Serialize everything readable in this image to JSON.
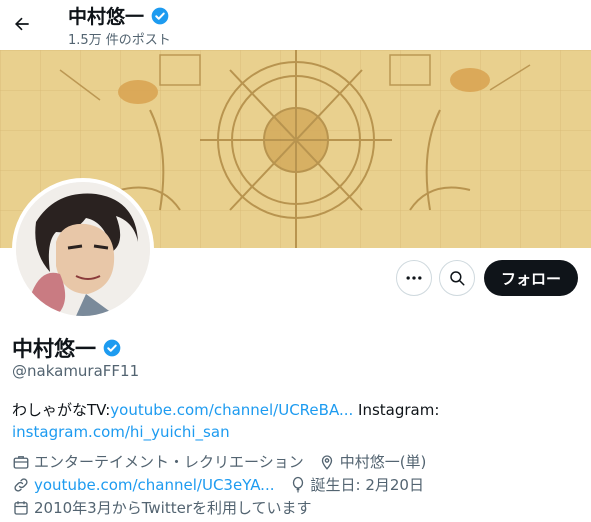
{
  "header": {
    "name": "中村悠一",
    "post_count": "1.5万 件のポスト"
  },
  "actions": {
    "follow_label": "フォロー"
  },
  "profile": {
    "name": "中村悠一",
    "handle": "@nakamuraFF11",
    "bio": {
      "prefix": "わしゃがなTV:",
      "link1": "youtube.com/channel/UCReBA...",
      "middle": " Instagram:",
      "link2": "instagram.com/hi_yuichi_san"
    },
    "meta": {
      "category": "エンターテイメント・レクリエーション",
      "location": "中村悠一(単)",
      "website": "youtube.com/channel/UC3eYA...",
      "birthday": "誕生日: 2月20日",
      "joined": "2010年3月からTwitterを利用しています"
    }
  },
  "colors": {
    "accent": "#1d9bf0",
    "text": "#0f1419",
    "secondary": "#536471",
    "banner": "#e8cf8a"
  }
}
